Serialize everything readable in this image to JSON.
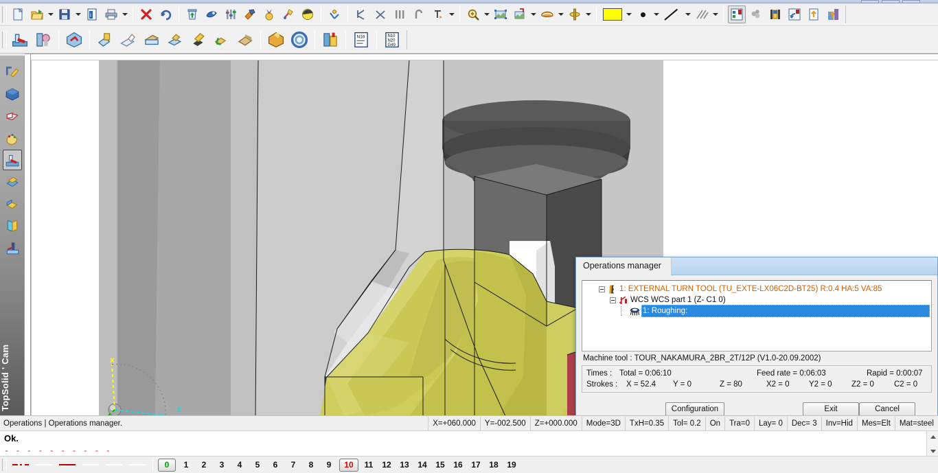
{
  "window": {
    "title_buttons": [
      "minimize",
      "maximize",
      "close"
    ]
  },
  "toolbar_main": {
    "groups": [
      {
        "items": [
          {
            "name": "new-document-icon",
            "glyph": "new",
            "arrow": false
          },
          {
            "name": "open-folder-icon",
            "glyph": "open",
            "arrow": true
          },
          {
            "name": "save-icon",
            "glyph": "save",
            "arrow": true
          },
          {
            "name": "document-properties-icon",
            "glyph": "info",
            "arrow": false
          },
          {
            "name": "print-icon",
            "glyph": "print",
            "arrow": true
          }
        ]
      },
      {
        "items": [
          {
            "name": "delete-icon",
            "glyph": "delete",
            "arrow": false
          },
          {
            "name": "undo-icon",
            "glyph": "undo",
            "arrow": false
          }
        ]
      },
      {
        "items": [
          {
            "name": "recycle-bin-icon",
            "glyph": "bin",
            "arrow": false
          },
          {
            "name": "analysis-icon",
            "glyph": "analysis",
            "arrow": false
          },
          {
            "name": "settings-sliders-icon",
            "glyph": "sliders",
            "arrow": false
          },
          {
            "name": "hammer-icon",
            "glyph": "hammer",
            "arrow": false
          },
          {
            "name": "medal-icon",
            "glyph": "medal",
            "arrow": false
          },
          {
            "name": "tools-icon",
            "glyph": "tools",
            "arrow": false
          },
          {
            "name": "simulation-icon",
            "glyph": "simulation",
            "arrow": false
          }
        ]
      },
      {
        "items": [
          {
            "name": "coordinate-system-icon",
            "glyph": "coord",
            "arrow": false
          }
        ]
      },
      {
        "items": [
          {
            "name": "snap-endpoint-icon",
            "glyph": "snap1",
            "arrow": false
          },
          {
            "name": "snap-intersection-icon",
            "glyph": "snap2",
            "arrow": false
          },
          {
            "name": "snap-midpoint-icon",
            "glyph": "snap3",
            "arrow": false
          },
          {
            "name": "snap-center-icon",
            "glyph": "snap4",
            "arrow": false
          },
          {
            "name": "snap-settings-icon",
            "glyph": "snap5",
            "arrow": true
          }
        ]
      },
      {
        "items": [
          {
            "name": "zoom-in-icon",
            "glyph": "zoomin",
            "arrow": true
          },
          {
            "name": "zoom-fit-icon",
            "glyph": "zoomfit",
            "arrow": false
          },
          {
            "name": "zoom-window-icon",
            "glyph": "zoomwin",
            "arrow": true
          },
          {
            "name": "view-orientation-icon",
            "glyph": "glasses",
            "arrow": true
          },
          {
            "name": "rotate-view-icon",
            "glyph": "rotate",
            "arrow": true
          }
        ]
      },
      {
        "items": [
          {
            "name": "color-swatch",
            "glyph": "swatch",
            "arrow": true,
            "color": "#ffff00"
          },
          {
            "name": "point-style-icon",
            "glyph": "dot",
            "arrow": true
          },
          {
            "name": "line-style-icon",
            "glyph": "line",
            "arrow": true
          },
          {
            "name": "hatch-style-icon",
            "glyph": "hatch",
            "arrow": true
          }
        ]
      },
      {
        "items": [
          {
            "name": "operations-manager-icon",
            "glyph": "opmgr",
            "arrow": false,
            "pressed": true
          },
          {
            "name": "stock-material-icon",
            "glyph": "stock",
            "arrow": false
          },
          {
            "name": "tool-magazine-icon",
            "glyph": "magazine",
            "arrow": false
          },
          {
            "name": "simulate-machining-icon",
            "glyph": "simulate",
            "arrow": false
          },
          {
            "name": "export-document-icon",
            "glyph": "export",
            "arrow": false
          },
          {
            "name": "post-processor-icon",
            "glyph": "postproc",
            "arrow": false
          }
        ]
      }
    ]
  },
  "toolbar_cam": {
    "groups": [
      {
        "items": [
          {
            "name": "machine-setup-icon",
            "glyph": "machine"
          },
          {
            "name": "tool-holder-icon",
            "glyph": "holder"
          }
        ]
      },
      {
        "items": [
          {
            "name": "part-positioning-icon",
            "glyph": "part"
          }
        ]
      },
      {
        "items": [
          {
            "name": "turning-roughing-icon",
            "glyph": "rough"
          },
          {
            "name": "turning-finishing-icon",
            "glyph": "finish"
          },
          {
            "name": "facing-icon",
            "glyph": "facing"
          },
          {
            "name": "grooving-icon",
            "glyph": "groove"
          },
          {
            "name": "threading-icon",
            "glyph": "thread"
          },
          {
            "name": "drilling-icon",
            "glyph": "drill"
          },
          {
            "name": "contouring-icon",
            "glyph": "contour"
          }
        ]
      },
      {
        "items": [
          {
            "name": "stock-definition-icon",
            "glyph": "stockdef"
          },
          {
            "name": "chuck-icon",
            "glyph": "chuck"
          }
        ]
      },
      {
        "items": [
          {
            "name": "tool-library-icon",
            "glyph": "toollib"
          }
        ]
      },
      {
        "items": [
          {
            "name": "nc-program-icon",
            "glyph": "nc1"
          }
        ]
      },
      {
        "items": [
          {
            "name": "nc-code-icon",
            "glyph": "nc2"
          }
        ]
      }
    ]
  },
  "sidebar": {
    "product_label": "TopSolid ' Cam",
    "items": [
      {
        "name": "sidebar-item-sketch",
        "glyph": "sketch",
        "active": false
      },
      {
        "name": "sidebar-item-solid",
        "glyph": "solid",
        "active": false
      },
      {
        "name": "sidebar-item-sheetmetal",
        "glyph": "sheetmetal",
        "active": false
      },
      {
        "name": "sidebar-item-design",
        "glyph": "design",
        "active": false
      },
      {
        "name": "sidebar-item-machining",
        "glyph": "machining",
        "active": true
      },
      {
        "name": "sidebar-item-mold",
        "glyph": "mold",
        "active": false
      },
      {
        "name": "sidebar-item-assembly",
        "glyph": "assembly",
        "active": false
      },
      {
        "name": "sidebar-item-drafting",
        "glyph": "drafting",
        "active": false
      },
      {
        "name": "sidebar-item-wirecut",
        "glyph": "wirecut",
        "active": false
      }
    ]
  },
  "viewport": {
    "axis": {
      "x_label": "x",
      "y_label": "y",
      "z_label": "z",
      "x_color": "#ffff00",
      "y_color": "#00b000",
      "z_color": "#00e5e5"
    }
  },
  "dialog": {
    "title": "Operations manager",
    "tree": [
      {
        "level": 0,
        "expander": true,
        "icon": "turn-tool-icon",
        "label": "1: EXTERNAL TURN TOOL (TU_EXTE-LX06C2D-BT25)  R:0.4  HA:5  VA:85",
        "color": "#d06000",
        "selected": false
      },
      {
        "level": 1,
        "expander": true,
        "icon": "wcs-icon",
        "label": "WCS WCS part 1 (Z-  C1 0)",
        "color": "#111111",
        "selected": false
      },
      {
        "level": 2,
        "expander": false,
        "icon": "roughing-icon",
        "label": "1: Roughing:",
        "color": "#ffffff",
        "selected": true
      }
    ],
    "machine_tool_label": "Machine tool : TOUR_NAKAMURA_2BR_2T/12P (V1.0-20.09.2002)",
    "info": {
      "times_label": "Times :",
      "total_label": "Total = 0:06:10",
      "feed_rate_label": "Feed rate = 0:06:03",
      "rapid_label": "Rapid = 0:00:07",
      "strokes_label": "Strokes :",
      "x_label": "X = 52.4",
      "y_label": "Y = 0",
      "z_label": "Z = 80",
      "x2_label": "X2 = 0",
      "y2_label": "Y2 = 0",
      "z2_label": "Z2 = 0",
      "c2_label": "C2 = 0"
    },
    "buttons": {
      "configuration": "Configuration",
      "exit": "Exit",
      "cancel": "Cancel"
    },
    "selection_color": "#2a8ae0"
  },
  "statusbar": {
    "context": "Operations | Operations manager.",
    "cells": [
      "X=+060.000",
      "Y=-002.500",
      "Z=+000.000",
      "Mode=3D",
      "TxH=0.35",
      "Tol= 0.2",
      "On",
      "Tra=0",
      "Lay= 0",
      "Dec= 3",
      "Inv=Hid",
      "Mes=Elt",
      "Mat=steel"
    ]
  },
  "command_area": {
    "message": "Ok.",
    "separator": "- - - - - - - - - -"
  },
  "layerbar": {
    "linestyles": [
      {
        "name": "linestyle-dashdot",
        "color": "#c00000",
        "pattern": "dashdot"
      },
      {
        "name": "linestyle-blank-1",
        "color": "#ffffff",
        "pattern": "solid"
      },
      {
        "name": "linestyle-solid-red",
        "color": "#c00000",
        "pattern": "solid"
      },
      {
        "name": "linestyle-blank-2",
        "color": "#ffffff",
        "pattern": "solid"
      },
      {
        "name": "linestyle-blank-3",
        "color": "#ffffff",
        "pattern": "solid"
      },
      {
        "name": "linestyle-blank-4",
        "color": "#ffffff",
        "pattern": "solid"
      }
    ],
    "layers": [
      "0",
      "1",
      "2",
      "3",
      "4",
      "5",
      "6",
      "7",
      "8",
      "9",
      "10",
      "11",
      "12",
      "13",
      "14",
      "15",
      "16",
      "17",
      "18",
      "19"
    ],
    "active_layer": "0",
    "highlight_layer": "10"
  }
}
